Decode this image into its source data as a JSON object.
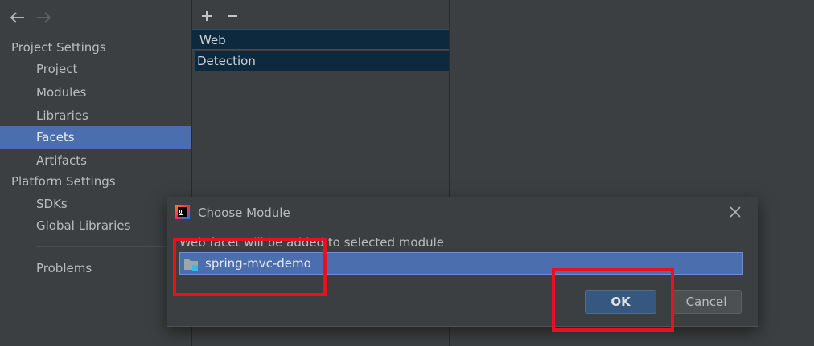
{
  "colors": {
    "background": "#3c3f41",
    "selection": "#4b6eaf",
    "facet_row": "#0d293e",
    "ok_button": "#365880",
    "annotation": "#e81123"
  },
  "sidebar": {
    "back_icon": "arrow-left-icon",
    "forward_icon": "arrow-right-icon",
    "project_settings_header": "Project Settings",
    "project_items": [
      {
        "label": "Project"
      },
      {
        "label": "Modules"
      },
      {
        "label": "Libraries"
      },
      {
        "label": "Facets",
        "selected": true
      },
      {
        "label": "Artifacts"
      }
    ],
    "platform_settings_header": "Platform Settings",
    "platform_items": [
      {
        "label": "SDKs"
      },
      {
        "label": "Global Libraries"
      }
    ],
    "problems_label": "Problems"
  },
  "middle": {
    "add_icon": "plus-icon",
    "remove_icon": "minus-icon",
    "facets": [
      {
        "label": "Web"
      },
      {
        "label": "Detection"
      }
    ]
  },
  "dialog": {
    "title": "Choose Module",
    "app_icon": "intellij-idea-icon",
    "app_icon_text": "IJ",
    "close_icon": "close-icon",
    "message": "Web facet will be added to selected module",
    "modules": [
      {
        "label": "spring-mvc-demo",
        "icon": "module-folder-icon",
        "selected": true
      }
    ],
    "ok_label": "OK",
    "cancel_label": "Cancel"
  }
}
